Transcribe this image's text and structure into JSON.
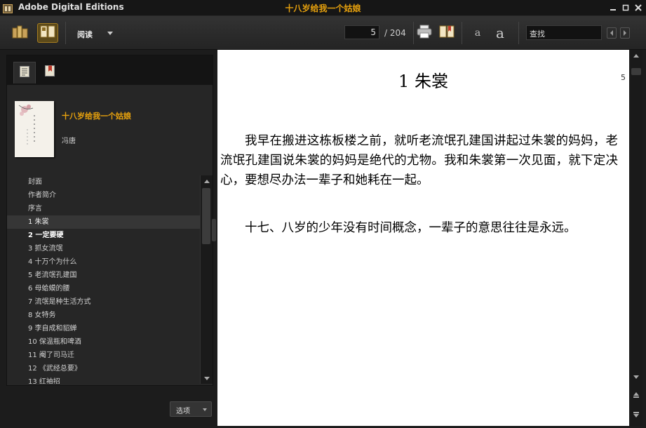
{
  "window": {
    "app_title": "Adobe Digital Editions",
    "book_title": "十八岁给我一个姑娘",
    "controls": [
      "minimize",
      "maximize",
      "close"
    ]
  },
  "toolbar": {
    "library_icon": "library-icon",
    "reading_icon": "reading-view-icon",
    "mode_label": "阅读",
    "page_current": "5",
    "page_total": "/ 204",
    "print_icon": "print-icon",
    "bookmark_icon": "bookmark-icon",
    "font_smaller": "a",
    "font_larger": "a",
    "search_value": "查找"
  },
  "sidebar": {
    "tabs": [
      "toc-tab",
      "bookmarks-tab"
    ],
    "book": {
      "title": "十八岁给我一个姑娘",
      "author": "冯唐"
    },
    "toc": [
      {
        "label": "封面"
      },
      {
        "label": "作者简介"
      },
      {
        "label": "序言"
      },
      {
        "label": "1 朱裳",
        "current": true
      },
      {
        "label": "2 一定要硬",
        "bold": true
      },
      {
        "label": "3 抓女流氓"
      },
      {
        "label": "4 十万个为什么"
      },
      {
        "label": "5 老流氓孔建国"
      },
      {
        "label": "6 母蛤蟆的腰"
      },
      {
        "label": "7 流氓是种生活方式"
      },
      {
        "label": "8 女特务"
      },
      {
        "label": "9 李自成和貂蝉"
      },
      {
        "label": "10 保温瓶和啤酒"
      },
      {
        "label": "11 阉了司马迁"
      },
      {
        "label": "12 《武经总要》"
      },
      {
        "label": "13 红袖招"
      }
    ],
    "options_label": "选项"
  },
  "reader": {
    "chapter_title": "1  朱裳",
    "page_number": "5",
    "paragraphs": [
      "我早在搬进这栋板楼之前，就听老流氓孔建国讲起过朱裳的妈妈，老流氓孔建国说朱裳的妈妈是绝代的尤物。我和朱裳第一次见面，就下定决心，要想尽办法一辈子和她耗在一起。",
      "十七、八岁的少年没有时间概念，一辈子的意思往往是永远。"
    ]
  },
  "colors": {
    "accent": "#e8a20d",
    "background": "#1c1c1c",
    "page": "#ffffff"
  }
}
